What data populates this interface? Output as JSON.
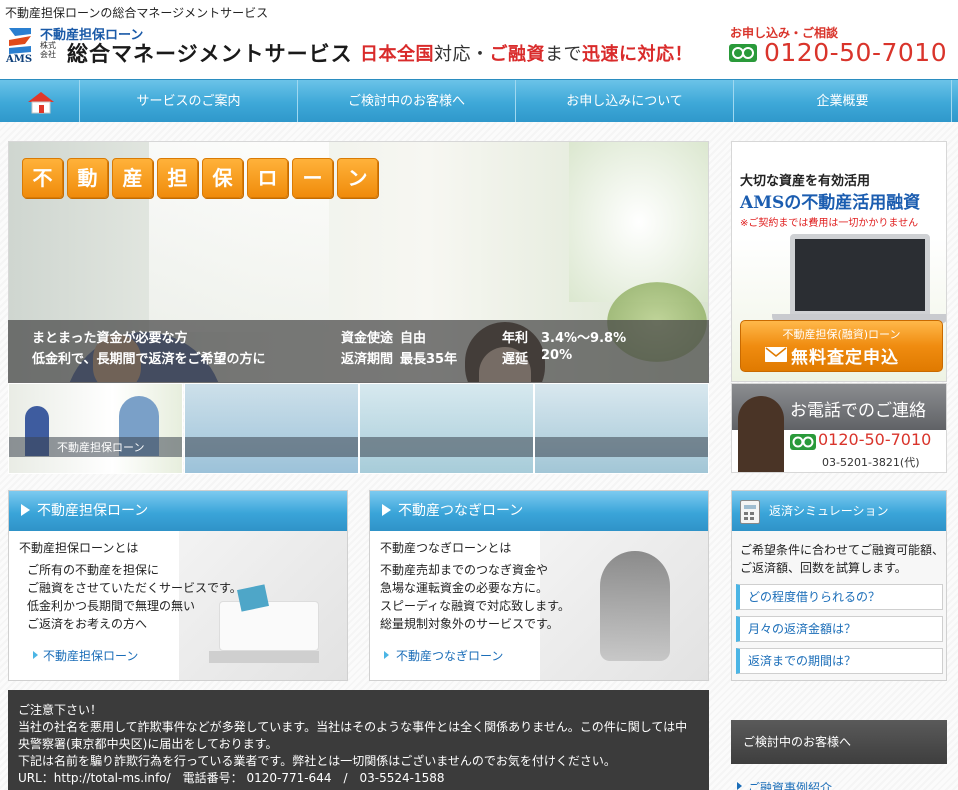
{
  "page": {
    "tagline": "不動産担保ローンの総合マネージメントサービス"
  },
  "header": {
    "logo_mark_text": "AMS",
    "logo_subtitle": "不動産担保ローン",
    "company_type": "株式会社",
    "company_name": "総合マネージメントサービス",
    "slogan_1": "日本全国",
    "slogan_2": "対応・",
    "slogan_3": "ご融資",
    "slogan_4": "まで",
    "slogan_5": "迅速に対応！",
    "contact_label": "お申し込み・ご相談",
    "phone": "0120-50-7010"
  },
  "nav": {
    "items": [
      {
        "label": "サービスのご案内"
      },
      {
        "label": "ご検討中のお客様へ"
      },
      {
        "label": "お申し込みについて"
      },
      {
        "label": "企業概要"
      }
    ]
  },
  "hero": {
    "title_chars": [
      "不",
      "動",
      "産",
      "担",
      "保",
      "ロ",
      "ー",
      "ン"
    ],
    "line1": "まとまった資金が必要な方",
    "line2": "低金利で、長期間で返済をご希望の方に",
    "usage_label": "資金使途",
    "usage_value": "自由",
    "period_label": "返済期間",
    "period_value": "最長35年",
    "rate_label": "年利",
    "rate_value": "3.4%〜9.8%",
    "late_label": "遅延",
    "late_value": "20%"
  },
  "thumbs": {
    "active_label": "不動産担保ローン"
  },
  "ams_box": {
    "line1": "大切な資産を有効活用",
    "line2": "AMSの不動産活用融資",
    "line3": "※ご契約までは費用は一切かかりません",
    "cta_small": "不動産担保(融資)ローン",
    "cta_big": "無料査定申込"
  },
  "phone_box": {
    "title": "お電話でのご連絡",
    "phone": "0120-50-7010",
    "phone2": "03-5201-3821(代)"
  },
  "panels": [
    {
      "title": "不動産担保ローン",
      "subtitle": "不動産担保ローンとは",
      "desc": "ご所有の不動産を担保に\nご融資をさせていただくサービスです。\n低金利かつ長期間で無理の無い\nご返済をお考えの方へ",
      "link": "不動産担保ローン"
    },
    {
      "title": "不動産つなぎローン",
      "subtitle": "不動産つなぎローンとは",
      "desc": "不動産売却までのつなぎ資金や\n急場な運転資金の必要な方に。\nスピーディな融資で対応致します。\n総量規制対象外のサービスです。",
      "link": "不動産つなぎローン"
    }
  ],
  "simulation": {
    "title": "返済シミュレーション",
    "desc": "ご希望条件に合わせてご融資可能額、\nご返済額、回数を試算します。",
    "links": [
      "どの程度借りられるの？",
      "月々の返済金額は？",
      "返済までの期間は？"
    ]
  },
  "notice": {
    "line1": "ご注意下さい！",
    "line2": "当社の社名を悪用して詐欺事件などが多発しています。当社はそのような事件とは全く関係ありません。この件に関しては中",
    "line3": "央警察署(東京都中央区)に届出をしております。",
    "line4": "下記は名前を騙り詐欺行為を行っている業者です。弊社とは一切関係はございませんのでお気を付けください。",
    "line5": "URL：http://total-ms.info/　電話番号：  0120-771-644　/　03-5524-1588"
  },
  "kentou": {
    "title": "ご検討中のお客様へ",
    "link": "ご融資事例紹介"
  },
  "colors": {
    "accent_blue": "#3ea8d8",
    "accent_orange": "#f08c10",
    "phone_red": "#d9342b"
  }
}
